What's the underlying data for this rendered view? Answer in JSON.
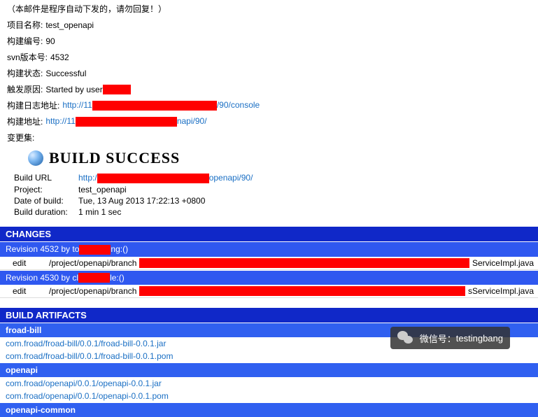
{
  "header_note": "（本邮件是程序自动下发的，请勿回复！）",
  "info": {
    "project_name_label": "项目名称:",
    "project_name_value": "test_openapi",
    "build_no_label": "构建编号:",
    "build_no_value": "90",
    "svn_label": "svn版本号:",
    "svn_value": "4532",
    "status_label": "构建状态:",
    "status_value": "Successful",
    "cause_label": "触发原因:",
    "cause_value": "Started by user ",
    "log_url_label": "构建日志地址:",
    "log_url_prefix": "http://11",
    "log_url_suffix": "/90/console",
    "build_url_label": "构建地址:",
    "build_url_prefix": "http://11",
    "build_url_suffix": "napi/90/",
    "changes_label": "变更集:"
  },
  "build_success": "BUILD SUCCESS",
  "details": {
    "build_url_label": "Build URL",
    "build_url_prefix": "http:/",
    "build_url_suffix": "openapi/90/",
    "project_label": "Project:",
    "project_value": "test_openapi",
    "date_label": "Date of build:",
    "date_value": "Tue, 13 Aug 2013 17:22:13 +0800",
    "duration_label": "Build duration:",
    "duration_value": "1 min 1 sec"
  },
  "changes": {
    "header": "CHANGES",
    "revisions": [
      {
        "rev_prefix": "Revision 4532 by to",
        "rev_suffix": "ng:()",
        "edit_label": "edit",
        "path_prefix": "/project/openapi/branch",
        "file_suffix": "ServiceImpl.java"
      },
      {
        "rev_prefix": "Revision 4530 by cl",
        "rev_suffix": "le:()",
        "edit_label": "edit",
        "path_prefix": "/project/openapi/branch",
        "file_suffix": "sServiceImpl.java"
      }
    ]
  },
  "artifacts": {
    "header": "BUILD ARTIFACTS",
    "groups": [
      {
        "name": "froad-bill",
        "links": [
          "com.froad/froad-bill/0.0.1/froad-bill-0.0.1.jar",
          "com.froad/froad-bill/0.0.1/froad-bill-0.0.1.pom"
        ]
      },
      {
        "name": "openapi",
        "links": [
          "com.froad/openapi/0.0.1/openapi-0.0.1.jar",
          "com.froad/openapi/0.0.1/openapi-0.0.1.pom"
        ]
      },
      {
        "name": "openapi-common",
        "links": []
      }
    ]
  },
  "wechat": {
    "label": "微信号：",
    "value": "testingbang"
  }
}
